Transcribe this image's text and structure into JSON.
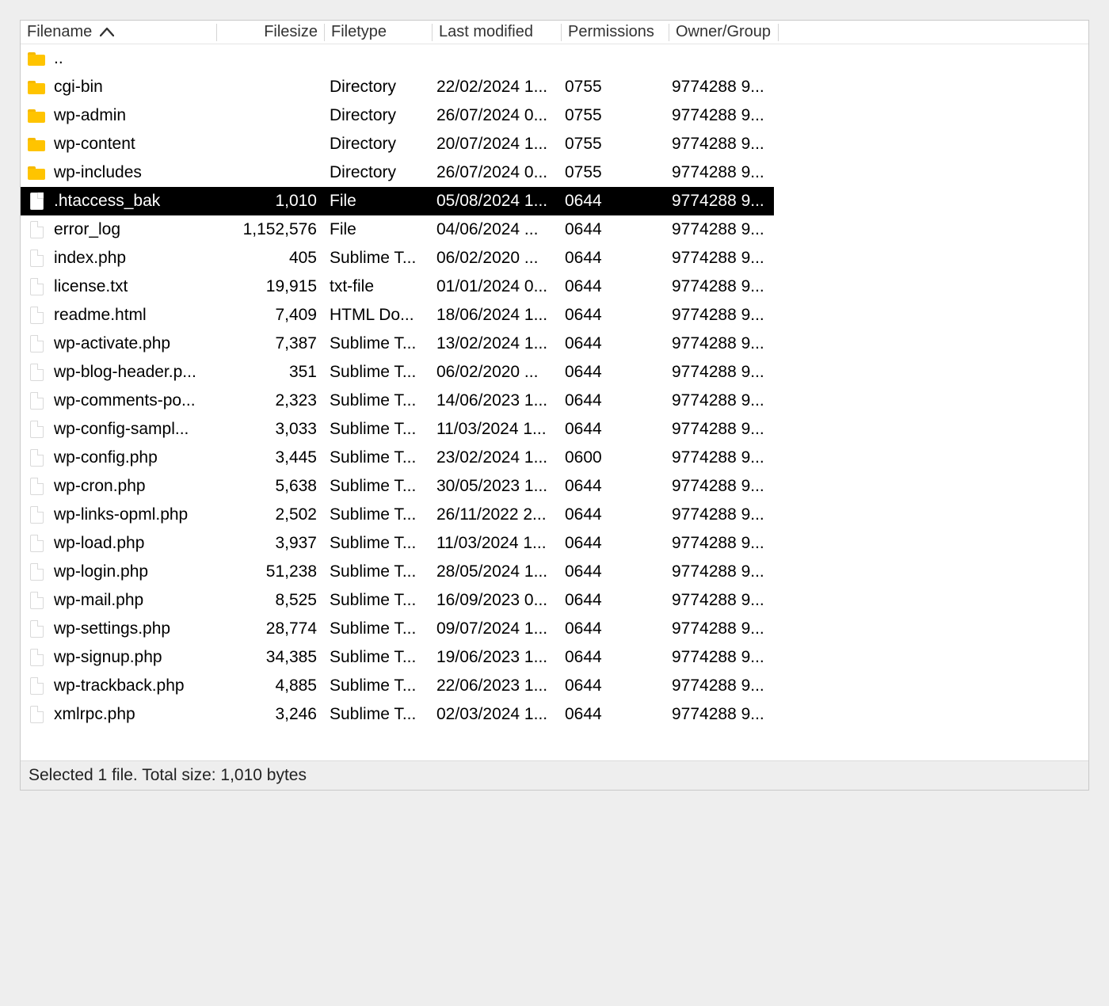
{
  "columns": {
    "filename": "Filename",
    "filesize": "Filesize",
    "filetype": "Filetype",
    "modified": "Last modified",
    "permissions": "Permissions",
    "owner": "Owner/Group"
  },
  "sort": {
    "column": "filename",
    "dir": "asc"
  },
  "rows": [
    {
      "type": "parent",
      "name": "..",
      "size": "",
      "ftype": "",
      "mod": "",
      "perm": "",
      "own": "",
      "selected": false
    },
    {
      "type": "dir",
      "name": "cgi-bin",
      "size": "",
      "ftype": "Directory",
      "mod": "22/02/2024 1...",
      "perm": "0755",
      "own": "9774288 9...",
      "selected": false
    },
    {
      "type": "dir",
      "name": "wp-admin",
      "size": "",
      "ftype": "Directory",
      "mod": "26/07/2024 0...",
      "perm": "0755",
      "own": "9774288 9...",
      "selected": false
    },
    {
      "type": "dir",
      "name": "wp-content",
      "size": "",
      "ftype": "Directory",
      "mod": "20/07/2024 1...",
      "perm": "0755",
      "own": "9774288 9...",
      "selected": false
    },
    {
      "type": "dir",
      "name": "wp-includes",
      "size": "",
      "ftype": "Directory",
      "mod": "26/07/2024 0...",
      "perm": "0755",
      "own": "9774288 9...",
      "selected": false
    },
    {
      "type": "file",
      "name": ".htaccess_bak",
      "size": "1,010",
      "ftype": "File",
      "mod": "05/08/2024 1...",
      "perm": "0644",
      "own": "9774288 9...",
      "selected": true
    },
    {
      "type": "file",
      "name": "error_log",
      "size": "1,152,576",
      "ftype": "File",
      "mod": "04/06/2024 ...",
      "perm": "0644",
      "own": "9774288 9...",
      "selected": false
    },
    {
      "type": "file",
      "name": "index.php",
      "size": "405",
      "ftype": "Sublime T...",
      "mod": "06/02/2020 ...",
      "perm": "0644",
      "own": "9774288 9...",
      "selected": false
    },
    {
      "type": "file",
      "name": "license.txt",
      "size": "19,915",
      "ftype": "txt-file",
      "mod": "01/01/2024 0...",
      "perm": "0644",
      "own": "9774288 9...",
      "selected": false
    },
    {
      "type": "file",
      "name": "readme.html",
      "size": "7,409",
      "ftype": "HTML Do...",
      "mod": "18/06/2024 1...",
      "perm": "0644",
      "own": "9774288 9...",
      "selected": false
    },
    {
      "type": "file",
      "name": "wp-activate.php",
      "size": "7,387",
      "ftype": "Sublime T...",
      "mod": "13/02/2024 1...",
      "perm": "0644",
      "own": "9774288 9...",
      "selected": false
    },
    {
      "type": "file",
      "name": "wp-blog-header.p...",
      "size": "351",
      "ftype": "Sublime T...",
      "mod": "06/02/2020 ...",
      "perm": "0644",
      "own": "9774288 9...",
      "selected": false
    },
    {
      "type": "file",
      "name": "wp-comments-po...",
      "size": "2,323",
      "ftype": "Sublime T...",
      "mod": "14/06/2023 1...",
      "perm": "0644",
      "own": "9774288 9...",
      "selected": false
    },
    {
      "type": "file",
      "name": "wp-config-sampl...",
      "size": "3,033",
      "ftype": "Sublime T...",
      "mod": "11/03/2024 1...",
      "perm": "0644",
      "own": "9774288 9...",
      "selected": false
    },
    {
      "type": "file",
      "name": "wp-config.php",
      "size": "3,445",
      "ftype": "Sublime T...",
      "mod": "23/02/2024 1...",
      "perm": "0600",
      "own": "9774288 9...",
      "selected": false
    },
    {
      "type": "file",
      "name": "wp-cron.php",
      "size": "5,638",
      "ftype": "Sublime T...",
      "mod": "30/05/2023 1...",
      "perm": "0644",
      "own": "9774288 9...",
      "selected": false
    },
    {
      "type": "file",
      "name": "wp-links-opml.php",
      "size": "2,502",
      "ftype": "Sublime T...",
      "mod": "26/11/2022 2...",
      "perm": "0644",
      "own": "9774288 9...",
      "selected": false
    },
    {
      "type": "file",
      "name": "wp-load.php",
      "size": "3,937",
      "ftype": "Sublime T...",
      "mod": "11/03/2024 1...",
      "perm": "0644",
      "own": "9774288 9...",
      "selected": false
    },
    {
      "type": "file",
      "name": "wp-login.php",
      "size": "51,238",
      "ftype": "Sublime T...",
      "mod": "28/05/2024 1...",
      "perm": "0644",
      "own": "9774288 9...",
      "selected": false
    },
    {
      "type": "file",
      "name": "wp-mail.php",
      "size": "8,525",
      "ftype": "Sublime T...",
      "mod": "16/09/2023 0...",
      "perm": "0644",
      "own": "9774288 9...",
      "selected": false
    },
    {
      "type": "file",
      "name": "wp-settings.php",
      "size": "28,774",
      "ftype": "Sublime T...",
      "mod": "09/07/2024 1...",
      "perm": "0644",
      "own": "9774288 9...",
      "selected": false
    },
    {
      "type": "file",
      "name": "wp-signup.php",
      "size": "34,385",
      "ftype": "Sublime T...",
      "mod": "19/06/2023 1...",
      "perm": "0644",
      "own": "9774288 9...",
      "selected": false
    },
    {
      "type": "file",
      "name": "wp-trackback.php",
      "size": "4,885",
      "ftype": "Sublime T...",
      "mod": "22/06/2023 1...",
      "perm": "0644",
      "own": "9774288 9...",
      "selected": false
    },
    {
      "type": "file",
      "name": "xmlrpc.php",
      "size": "3,246",
      "ftype": "Sublime T...",
      "mod": "02/03/2024 1...",
      "perm": "0644",
      "own": "9774288 9...",
      "selected": false
    }
  ],
  "status": "Selected 1 file. Total size: 1,010 bytes"
}
